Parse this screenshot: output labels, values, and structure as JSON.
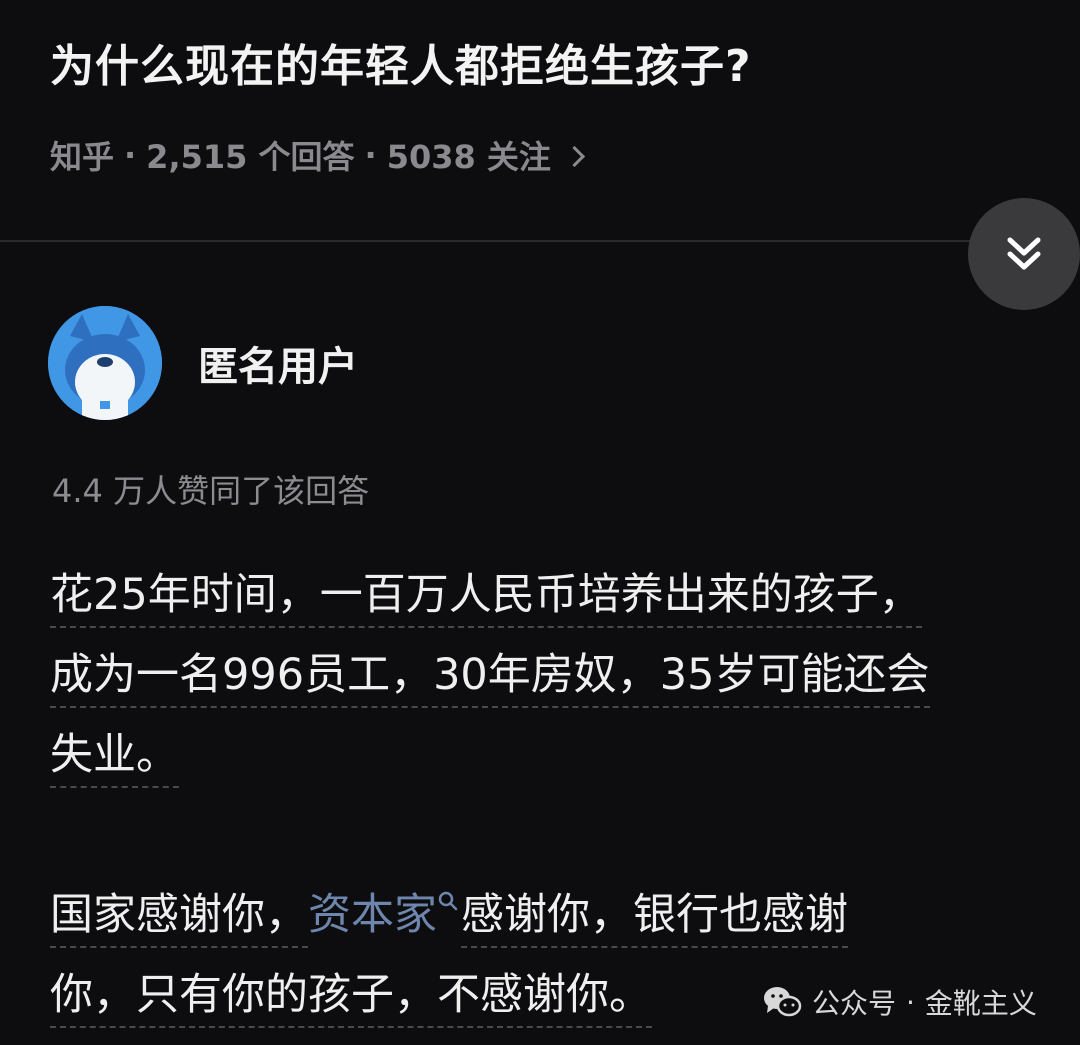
{
  "question": {
    "title": "为什么现在的年轻人都拒绝生孩子?",
    "meta": {
      "site": "知乎",
      "sep": "·",
      "answers": "2,515 个回答",
      "follows": "5038 关注"
    }
  },
  "answer": {
    "author": "匿名用户",
    "likes": "4.4 万人赞同了该回答",
    "para1": [
      "花25年时间，一百万人民币培养出来的孩子，",
      "成为一名996员工，30年房奴，35岁可能还会",
      "失业。"
    ],
    "para2": {
      "line1_before": "国家感谢你，",
      "line1_link": "资本家",
      "line1_after": "感谢你，银行也感谢",
      "line2": "你，只有你的孩子，不感谢你。"
    }
  },
  "watermark": {
    "text": "公众号",
    "sep": "·",
    "account": "金靴主义"
  },
  "colors": {
    "background": "#0d0d0f",
    "link": "#6e86ad",
    "muted": "#8a8a8e"
  },
  "icons": [
    "collapse-double-chevron-icon",
    "search-icon",
    "wechat-icon",
    "chevron-right-icon"
  ]
}
